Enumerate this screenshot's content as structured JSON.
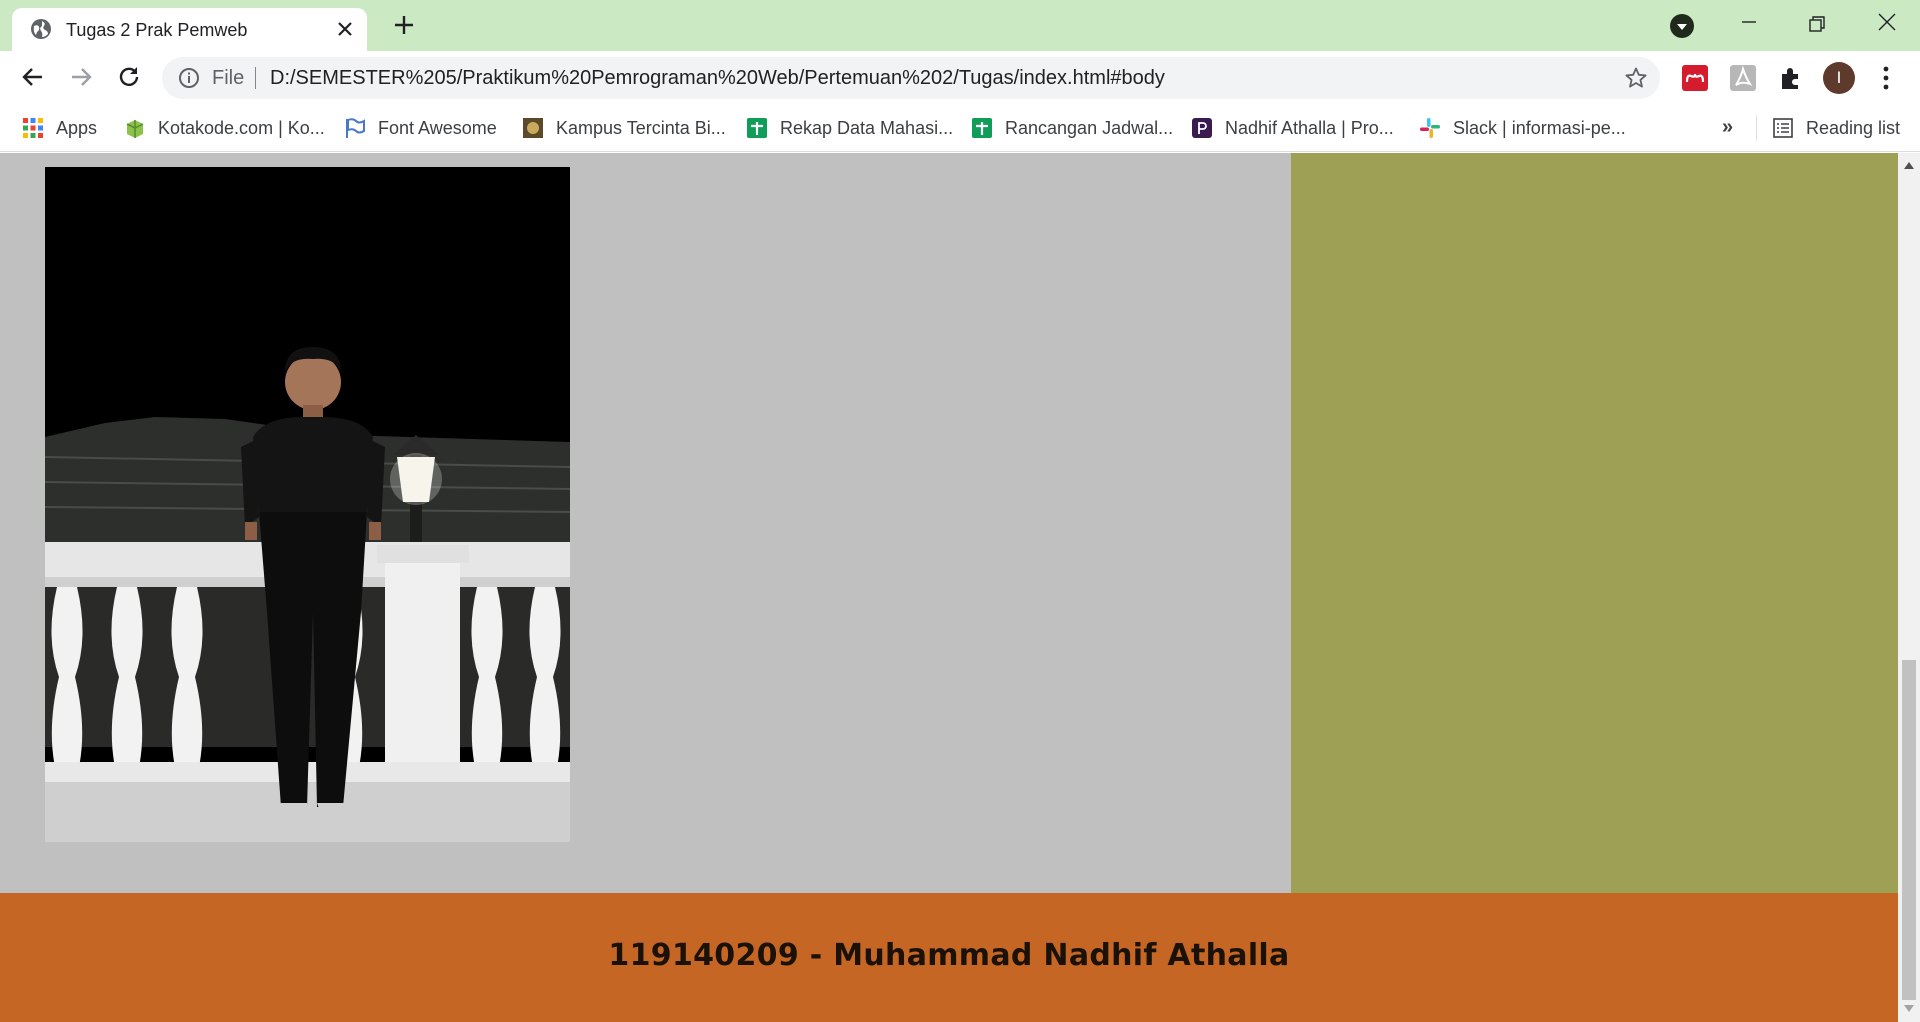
{
  "browser": {
    "tab": {
      "title": "Tugas 2 Prak Pemweb",
      "icon": "globe-icon"
    },
    "omnibox": {
      "scheme_label": "File",
      "url": "D:/SEMESTER%205/Praktikum%20Pemrograman%20Web/Pertemuan%202/Tugas/index.html#body"
    },
    "profile_initial": "I",
    "bookmarks": [
      {
        "label": "Apps",
        "icon": "apps-grid-icon"
      },
      {
        "label": "Kotakode.com | Ko...",
        "icon": "kotakode-icon"
      },
      {
        "label": "Font Awesome",
        "icon": "flag-icon"
      },
      {
        "label": "Kampus Tercinta Bi...",
        "icon": "campus-logo-icon"
      },
      {
        "label": "Rekap Data Mahasi...",
        "icon": "sheets-icon"
      },
      {
        "label": "Rancangan Jadwal...",
        "icon": "sheets-icon"
      },
      {
        "label": "Nadhif Athalla | Pro...",
        "icon": "profile-site-icon"
      },
      {
        "label": "Slack | informasi-pe...",
        "icon": "slack-icon"
      }
    ],
    "more_bookmarks_label": "»",
    "reading_list_label": "Reading list"
  },
  "page": {
    "footer_text": "119140209 - Muhammad Nadhif Athalla",
    "colors": {
      "main_bg": "#c0c0c0",
      "aside_bg": "#9ea055",
      "footer_bg": "#c66624",
      "tab_strip": "#cbe9c3"
    }
  }
}
